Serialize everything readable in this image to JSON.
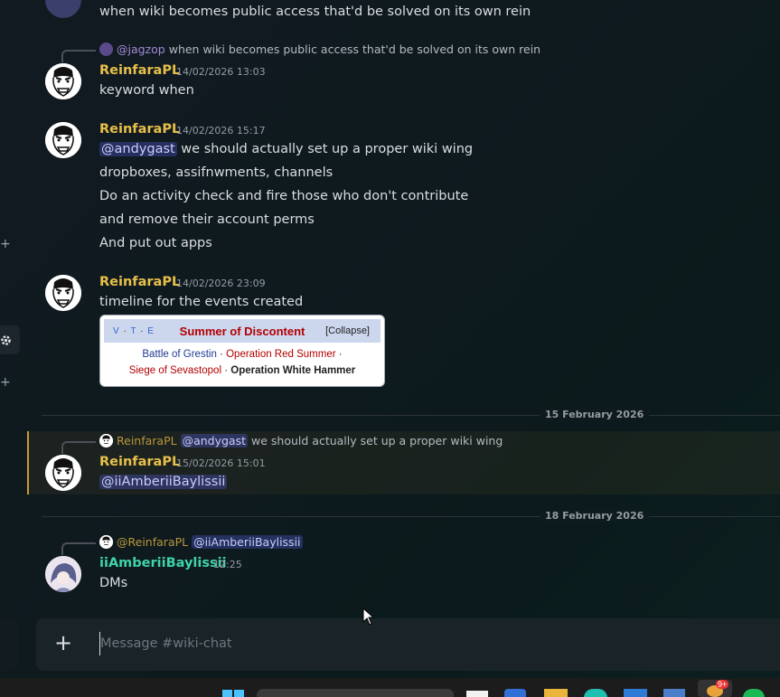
{
  "messages": {
    "top_line": "when wiki becomes public access that'd be solved on its own rein",
    "m1": {
      "reply_name": "@jagzop",
      "reply_text": "when wiki becomes public access that'd be solved on its own rein",
      "username": "ReinfaraPL",
      "timestamp": "14/02/2026 13:03",
      "lines": [
        "keyword when"
      ]
    },
    "m2": {
      "username": "ReinfaraPL",
      "timestamp": "14/02/2026 15:17",
      "mention": "@andygast",
      "first_line_rest": " we should actually set up a proper wiki wing",
      "lines": [
        "dropboxes, assifnwments, channels",
        "Do an activity check and fire those who don't contribute",
        "and remove their account perms",
        "And put out apps"
      ]
    },
    "m3": {
      "username": "ReinfaraPL",
      "timestamp": "14/02/2026 23:09",
      "lines": [
        "timeline for the events created"
      ],
      "navbox": {
        "vte": [
          "V",
          "T",
          "E"
        ],
        "title": "Summer of Discontent",
        "collapse": "[Collapse]",
        "row1": [
          "Battle of Grestin",
          "Operation Red Summer"
        ],
        "row2": [
          "Siege of Sevastopol",
          "Operation White Hammer"
        ],
        "separator": "·"
      }
    },
    "divider1": "15 February 2026",
    "m4": {
      "reply_name": "ReinfaraPL",
      "reply_mention": "@andygast",
      "reply_text": "we should actually set up a proper wiki wing",
      "username": "ReinfaraPL",
      "timestamp": "15/02/2026 15:01",
      "mention": "@iiAmberiiBaylissii"
    },
    "divider2": "18 February 2026",
    "m5": {
      "reply_name": "@ReinfaraPL",
      "reply_mention": "@iiAmberiiBaylissii",
      "username": "iiAmberiiBaylissii",
      "timestamp": "12:25",
      "lines": [
        "DMs"
      ]
    }
  },
  "composer": {
    "placeholder": "Message #wiki-chat"
  },
  "taskbar": {
    "badge": "9+"
  },
  "colors": {
    "username_gold": "#e8c04a",
    "username_teal": "#3fd3a8",
    "mention_bg": "#5865f2",
    "navbox_title": "#b30000"
  }
}
